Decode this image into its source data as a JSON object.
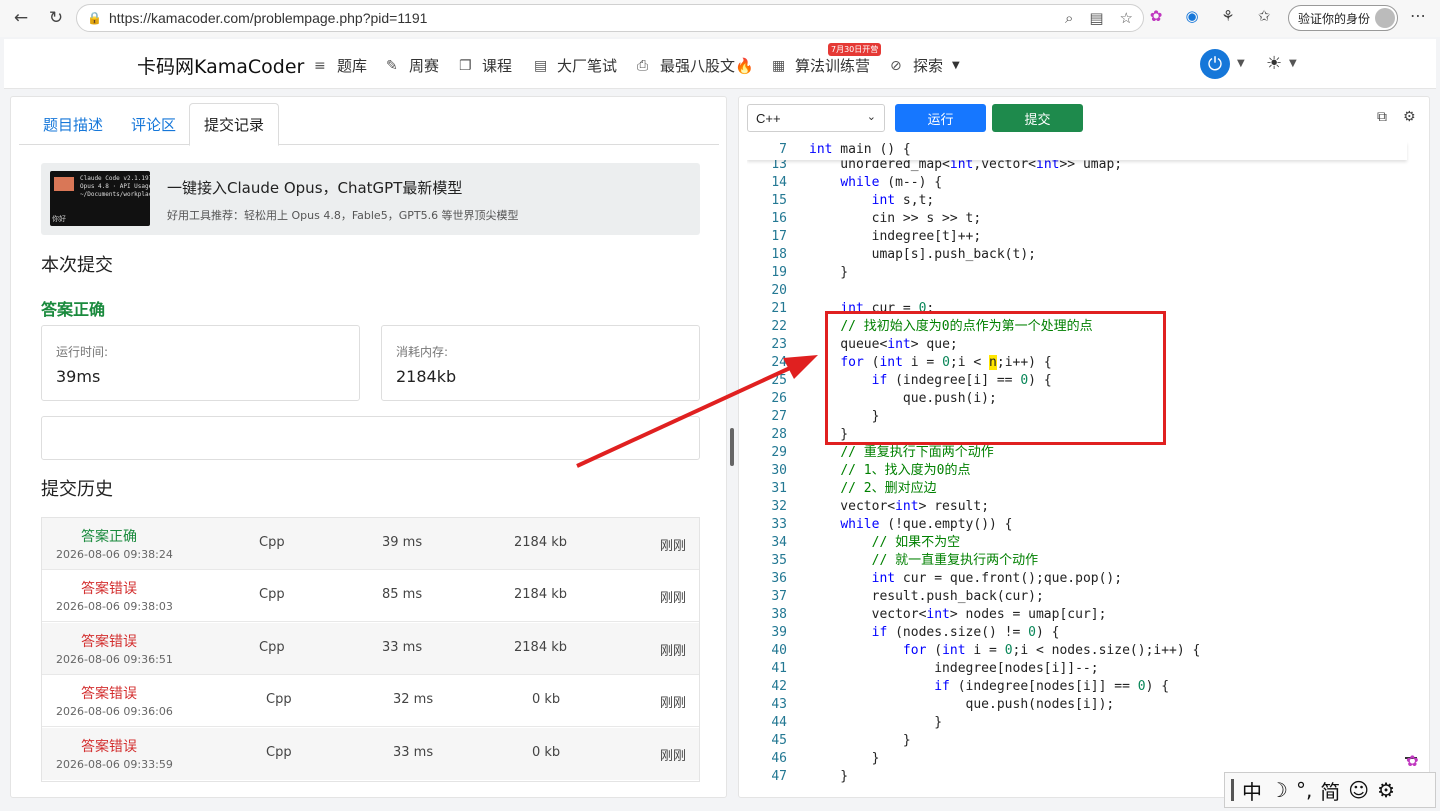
{
  "browser": {
    "url": "https://kamacoder.com/problempage.php?pid=1191",
    "verify_label": "验证你的身份"
  },
  "header": {
    "brand": "卡码网KamaCoder",
    "nav": [
      {
        "label": "题库",
        "icon": "list-icon"
      },
      {
        "label": "周赛",
        "icon": "pencil-icon"
      },
      {
        "label": "课程",
        "icon": "copy-icon"
      },
      {
        "label": "大厂笔试",
        "icon": "document-icon"
      },
      {
        "label": "最强八股文🔥",
        "icon": "code-file-icon"
      },
      {
        "label": "算法训练营",
        "icon": "calendar-icon"
      },
      {
        "label": "探索",
        "icon": "compass-icon"
      }
    ],
    "badge": "7月30日开营"
  },
  "left": {
    "tabs": [
      "题目描述",
      "评论区",
      "提交记录"
    ],
    "ad": {
      "title": "一键接入Claude Opus，ChatGPT最新模型",
      "subtitle": "好用工具推荐：轻松用上 Opus 4.8，Fable5，GPT5.6 等世界顶尖模型",
      "thumb_text": "Claude Code v2.1.197\nOpus 4.8 · API Usage\n~/Documents/workplace",
      "thumb_hi": "你好"
    },
    "current_title": "本次提交",
    "result": "答案正确",
    "runtime_label": "运行时间:",
    "runtime_value": "39ms",
    "memory_label": "消耗内存:",
    "memory_value": "2184kb",
    "history_title": "提交历史",
    "history": [
      {
        "status": "答案正确",
        "ok": true,
        "time": "2026-08-06 09:38:24",
        "lang": "Cpp",
        "runtime": "39 ms",
        "memory": "2184 kb",
        "when": "刚刚"
      },
      {
        "status": "答案错误",
        "ok": false,
        "time": "2026-08-06 09:38:03",
        "lang": "Cpp",
        "runtime": "85 ms",
        "memory": "2184 kb",
        "when": "刚刚"
      },
      {
        "status": "答案错误",
        "ok": false,
        "time": "2026-08-06 09:36:51",
        "lang": "Cpp",
        "runtime": "33 ms",
        "memory": "2184 kb",
        "when": "刚刚"
      },
      {
        "status": "答案错误",
        "ok": false,
        "time": "2026-08-06 09:36:06",
        "lang": "Cpp",
        "runtime": "32 ms",
        "memory": "0 kb",
        "when": "刚刚"
      },
      {
        "status": "答案错误",
        "ok": false,
        "time": "2026-08-06 09:33:59",
        "lang": "Cpp",
        "runtime": "33 ms",
        "memory": "0 kb",
        "when": "刚刚"
      }
    ]
  },
  "right": {
    "language": "C++",
    "run_label": "运行",
    "submit_label": "提交",
    "sticky": {
      "ln": "7",
      "html": "<span class='kw'>int</span> main () {"
    },
    "code": [
      {
        "ln": "13",
        "html": "    unordered_map&lt;<span class='kw'>int</span>,vector&lt;<span class='kw'>int</span>&gt;&gt; umap;"
      },
      {
        "ln": "14",
        "html": "    <span class='kw'>while</span> (m--) {"
      },
      {
        "ln": "15",
        "html": "        <span class='kw'>int</span> s,t;"
      },
      {
        "ln": "16",
        "html": "        cin &gt;&gt; s &gt;&gt; t;"
      },
      {
        "ln": "17",
        "html": "        indegree[t]++;"
      },
      {
        "ln": "18",
        "html": "        umap[s].push_back(t);"
      },
      {
        "ln": "19",
        "html": "    }"
      },
      {
        "ln": "20",
        "html": ""
      },
      {
        "ln": "21",
        "html": "    <span class='kw'>int</span> cur = <span class='nm'>0</span>;"
      },
      {
        "ln": "22",
        "html": "    <span class='cm'>// 找初始入度为0的点作为第一个处理的点</span>"
      },
      {
        "ln": "23",
        "html": "    queue&lt;<span class='kw'>int</span>&gt; que;"
      },
      {
        "ln": "24",
        "html": "    <span class='kw'>for</span> (<span class='kw'>int</span> i = <span class='nm'>0</span>;i &lt; <span class='hl'>n</span>;i++) {"
      },
      {
        "ln": "25",
        "html": "        <span class='kw'>if</span> (indegree[i] == <span class='nm'>0</span>) {"
      },
      {
        "ln": "26",
        "html": "            que.push(i);"
      },
      {
        "ln": "27",
        "html": "        }"
      },
      {
        "ln": "28",
        "html": "    }"
      },
      {
        "ln": "29",
        "html": "    <span class='cm'>// 重复执行下面两个动作</span>"
      },
      {
        "ln": "30",
        "html": "    <span class='cm'>// 1、找入度为0的点</span>"
      },
      {
        "ln": "31",
        "html": "    <span class='cm'>// 2、删对应边</span>"
      },
      {
        "ln": "32",
        "html": "    vector&lt;<span class='kw'>int</span>&gt; result;"
      },
      {
        "ln": "33",
        "html": "    <span class='kw'>while</span> (!que.empty()) {"
      },
      {
        "ln": "34",
        "html": "        <span class='cm'>// 如果不为空</span>"
      },
      {
        "ln": "35",
        "html": "        <span class='cm'>// 就一直重复执行两个动作</span>"
      },
      {
        "ln": "36",
        "html": "        <span class='kw'>int</span> cur = que.front();que.pop();"
      },
      {
        "ln": "37",
        "html": "        result.push_back(cur);"
      },
      {
        "ln": "38",
        "html": "        vector&lt;<span class='kw'>int</span>&gt; nodes = umap[cur];"
      },
      {
        "ln": "39",
        "html": "        <span class='kw'>if</span> (nodes.size() != <span class='nm'>0</span>) {"
      },
      {
        "ln": "40",
        "html": "            <span class='kw'>for</span> (<span class='kw'>int</span> i = <span class='nm'>0</span>;i &lt; nodes.size();i++) {"
      },
      {
        "ln": "41",
        "html": "                indegree[nodes[i]]--;"
      },
      {
        "ln": "42",
        "html": "                <span class='kw'>if</span> (indegree[nodes[i]] == <span class='nm'>0</span>) {"
      },
      {
        "ln": "43",
        "html": "                    que.push(nodes[i]);"
      },
      {
        "ln": "44",
        "html": "                }"
      },
      {
        "ln": "45",
        "html": "            }"
      },
      {
        "ln": "46",
        "html": "        }"
      },
      {
        "ln": "47",
        "html": "    }"
      }
    ]
  },
  "ime": [
    "中",
    "☽",
    "°,",
    "简",
    "☺",
    "⚙"
  ],
  "colors": {
    "accent": "#1677ff",
    "success": "#1a8a3d",
    "error": "#d32f2f",
    "annotation": "#e02020"
  }
}
